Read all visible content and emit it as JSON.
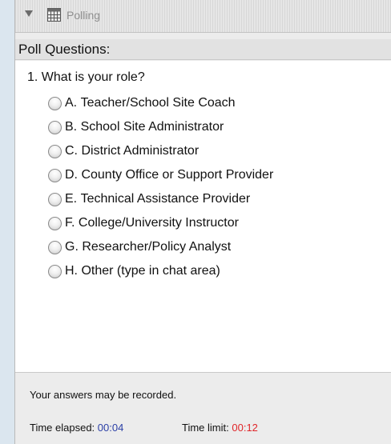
{
  "panel": {
    "title": "Polling",
    "section_header": "Poll Questions:"
  },
  "question": {
    "text": "1. What is your role?",
    "options": [
      {
        "letter": "A.",
        "label": "Teacher/School Site Coach"
      },
      {
        "letter": "B.",
        "label": "School Site Administrator"
      },
      {
        "letter": "C.",
        "label": "District Administrator"
      },
      {
        "letter": "D.",
        "label": "County Office or Support Provider"
      },
      {
        "letter": "E.",
        "label": "Technical Assistance Provider"
      },
      {
        "letter": "F.",
        "label": "College/University Instructor"
      },
      {
        "letter": "G.",
        "label": "Researcher/Policy Analyst"
      },
      {
        "letter": "H.",
        "label": "Other (type in chat area)"
      }
    ]
  },
  "footer": {
    "notice": "Your answers may be recorded.",
    "elapsed_label": "Time elapsed:",
    "elapsed_value": "00:04",
    "limit_label": "Time limit:",
    "limit_value": "00:12"
  },
  "colors": {
    "elapsed": "#2b3fa6",
    "limit": "#e0262a",
    "background": "#dbe6ef"
  },
  "icons": [
    "disclosure-triangle-icon",
    "grid-icon",
    "radio-icon"
  ]
}
